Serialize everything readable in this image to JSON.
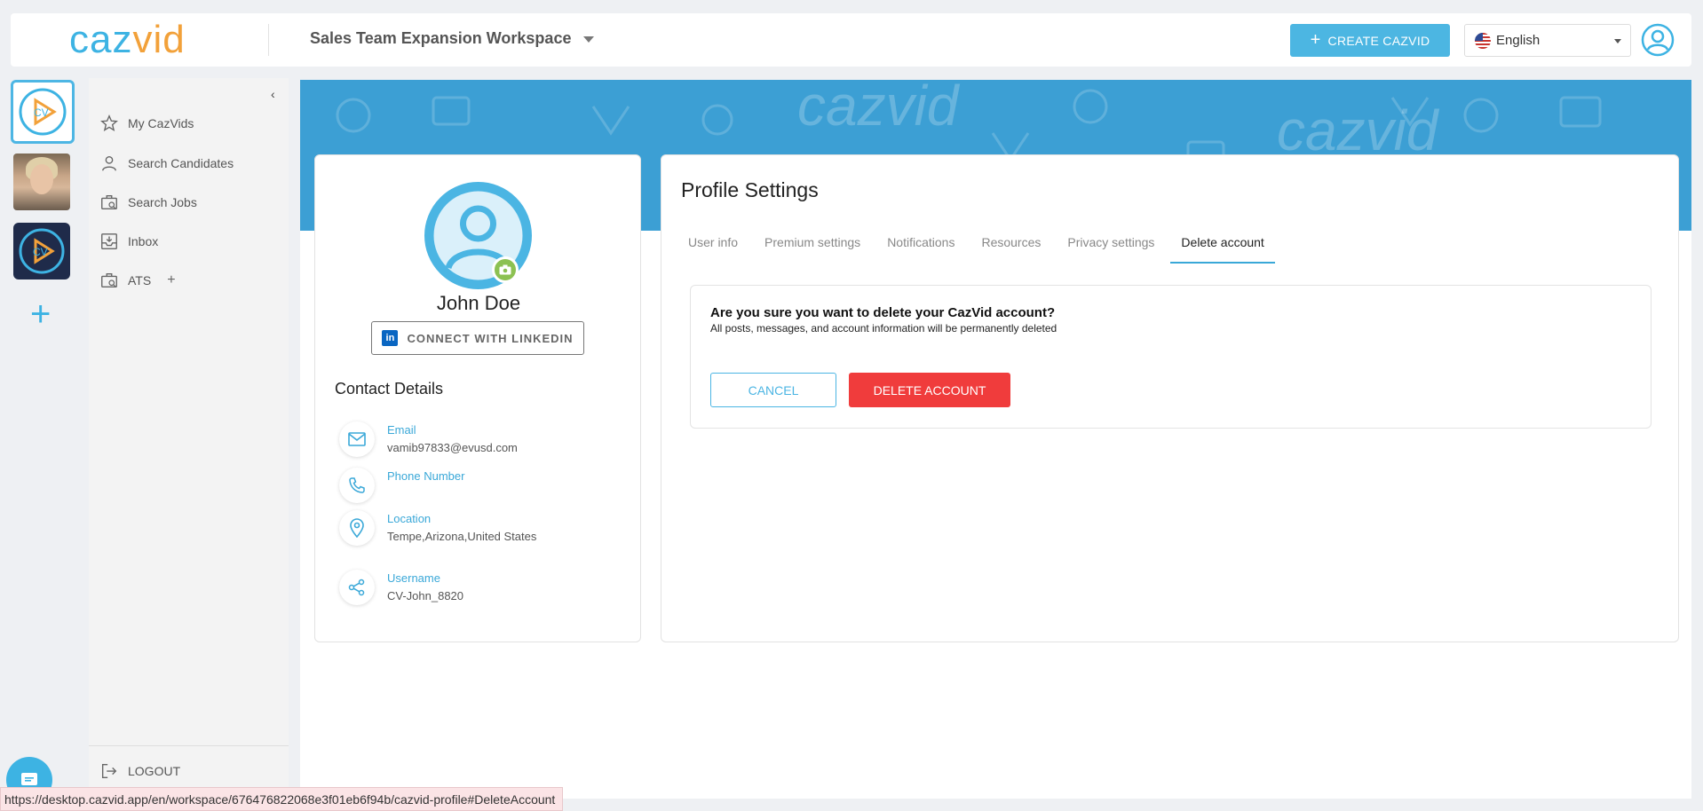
{
  "header": {
    "logo_part1": "caz",
    "logo_part2": "vid",
    "workspace": "Sales Team Expansion Workspace",
    "create_label": "CREATE CAZVID",
    "language": "English"
  },
  "sidebar": {
    "items": [
      {
        "label": "My CazVids",
        "icon": "star-icon"
      },
      {
        "label": "Search Candidates",
        "icon": "person-icon"
      },
      {
        "label": "Search Jobs",
        "icon": "briefcase-search-icon"
      },
      {
        "label": "Inbox",
        "icon": "inbox-icon"
      },
      {
        "label": "ATS",
        "icon": "briefcase-icon"
      }
    ],
    "logout": "LOGOUT"
  },
  "profile": {
    "name": "John Doe",
    "linkedin_label": "CONNECT WITH LINKEDIN",
    "contact_title": "Contact Details",
    "contacts": [
      {
        "label": "Email",
        "value": "vamib97833@evusd.com",
        "icon": "mail-icon"
      },
      {
        "label": "Phone Number",
        "value": "",
        "icon": "phone-icon"
      },
      {
        "label": "Location",
        "value": "Tempe,Arizona,United States",
        "icon": "location-icon"
      },
      {
        "label": "Username",
        "value": "CV-John_8820",
        "icon": "share-icon"
      }
    ]
  },
  "settings": {
    "title": "Profile Settings",
    "tabs": [
      "User info",
      "Premium settings",
      "Notifications",
      "Resources",
      "Privacy settings",
      "Delete account"
    ],
    "active_tab": "Delete account",
    "delete_question": "Are you sure you want to delete your CazVid account?",
    "delete_subtext": "All posts, messages, and account information will be permanently deleted",
    "cancel_label": "CANCEL",
    "delete_label": "DELETE ACCOUNT"
  },
  "status_url": "https://desktop.cazvid.app/en/workspace/676476822068e3f01eb6f94b/cazvid-profile#DeleteAccount",
  "colors": {
    "accent": "#3db3e3",
    "logo_orange": "#f2a13a",
    "danger": "#f03c3c",
    "banner": "#3c9fd4"
  }
}
